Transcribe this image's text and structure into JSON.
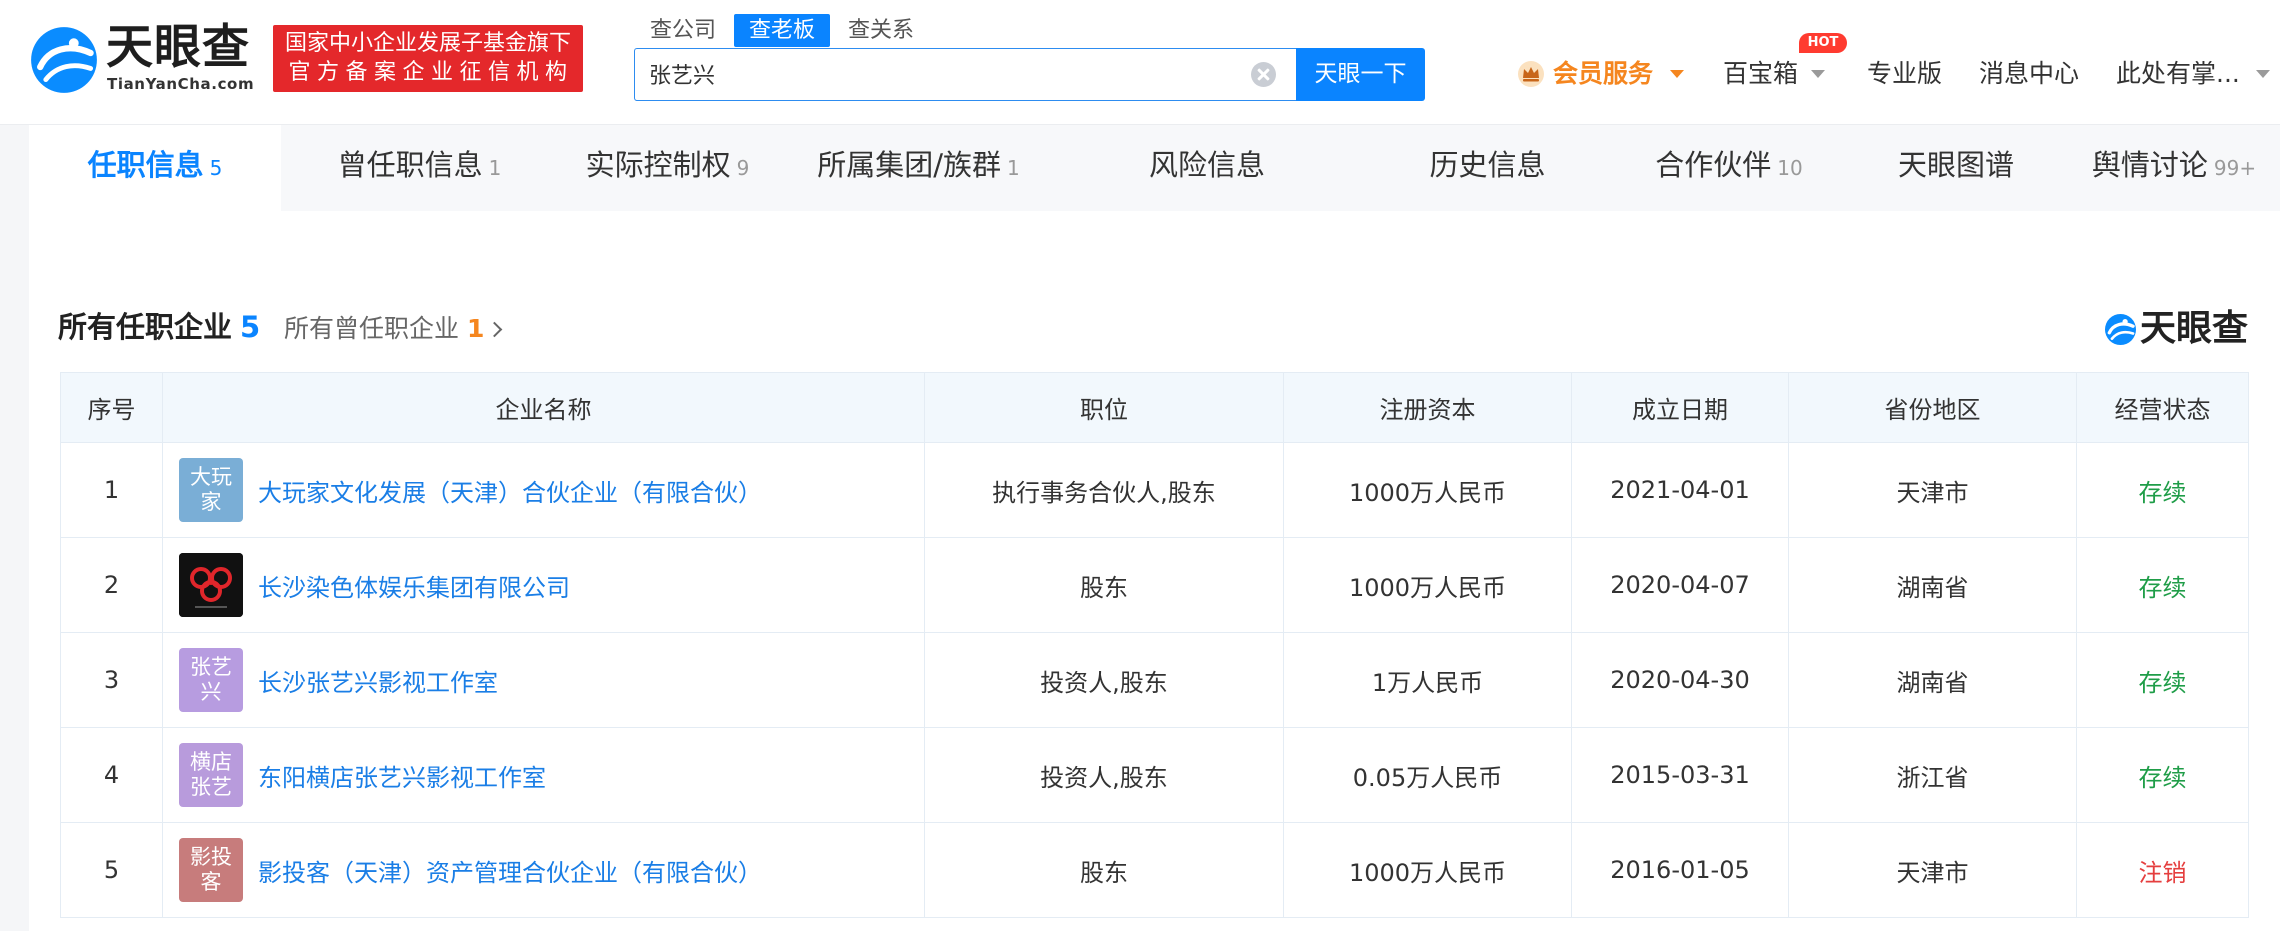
{
  "header": {
    "brand": "天眼查",
    "brand_sub": "TianYanCha.com",
    "banner_line1": "国家中小企业发展子基金旗下",
    "banner_line2": "官方备案企业征信机构",
    "search_tabs": [
      "查公司",
      "查老板",
      "查关系"
    ],
    "search_active_index": 1,
    "search_value": "张艺兴",
    "search_button": "天眼一下",
    "nav": {
      "vip": "会员服务",
      "toolbox": "百宝箱",
      "toolbox_badge": "HOT",
      "pro": "专业版",
      "messages": "消息中心",
      "user": "此处有掌..."
    }
  },
  "tabs": [
    {
      "label": "任职信息",
      "count": "5",
      "active": true
    },
    {
      "label": "曾任职信息",
      "count": "1"
    },
    {
      "label": "实际控制权",
      "count": "9"
    },
    {
      "label": "所属集团/族群",
      "count": "1"
    },
    {
      "label": "风险信息"
    },
    {
      "label": "历史信息"
    },
    {
      "label": "合作伙伴",
      "count": "10"
    },
    {
      "label": "天眼图谱"
    },
    {
      "label": "舆情讨论",
      "count": "99+"
    }
  ],
  "section": {
    "title": "所有任职企业",
    "count": "5",
    "former_label": "所有曾任职企业",
    "former_count": "1"
  },
  "watermark": "天眼查",
  "table": {
    "headers": [
      "序号",
      "企业名称",
      "职位",
      "注册资本",
      "成立日期",
      "省份地区",
      "经营状态"
    ],
    "rows": [
      {
        "index": "1",
        "logo": [
          "大玩",
          "家"
        ],
        "logo_color": "#7aaed6",
        "name": "大玩家文化发展（天津）合伙企业（有限合伙）",
        "position": "执行事务合伙人,股东",
        "capital": "1000万人民币",
        "founded": "2021-04-01",
        "region": "天津市",
        "status": "存续",
        "status_color": "#1f9d48"
      },
      {
        "index": "2",
        "logo_icon": "chromosome-logo-icon",
        "logo_color": "#111111",
        "name": "长沙染色体娱乐集团有限公司",
        "position": "股东",
        "capital": "1000万人民币",
        "founded": "2020-04-07",
        "region": "湖南省",
        "status": "存续",
        "status_color": "#1f9d48"
      },
      {
        "index": "3",
        "logo": [
          "张艺",
          "兴"
        ],
        "logo_color": "#b79ce0",
        "name": "长沙张艺兴影视工作室",
        "position": "投资人,股东",
        "capital": "1万人民币",
        "founded": "2020-04-30",
        "region": "湖南省",
        "status": "存续",
        "status_color": "#1f9d48"
      },
      {
        "index": "4",
        "logo": [
          "横店",
          "张艺"
        ],
        "logo_color": "#b89bdc",
        "name": "东阳横店张艺兴影视工作室",
        "position": "投资人,股东",
        "capital": "0.05万人民币",
        "founded": "2015-03-31",
        "region": "浙江省",
        "status": "存续",
        "status_color": "#1f9d48"
      },
      {
        "index": "5",
        "logo": [
          "影投",
          "客"
        ],
        "logo_color": "#c77c7c",
        "name": "影投客（天津）资产管理合伙企业（有限合伙）",
        "position": "股东",
        "capital": "1000万人民币",
        "founded": "2016-01-05",
        "region": "天津市",
        "status": "注销",
        "status_color": "#e53e3e"
      }
    ]
  },
  "icons": [
    "tianyancha-logo-icon",
    "clear-search-icon",
    "crown-icon",
    "chevron-down-icon",
    "chevron-right-icon",
    "chromosome-logo-icon"
  ],
  "colors": {
    "brand_blue": "#0a84ff",
    "link_blue": "#1a7ee6",
    "vip_orange": "#f5861f",
    "banner_red": "#e4282b",
    "hot_red": "#ff3b30",
    "status_active": "#1f9d48",
    "status_cancelled": "#e53e3e",
    "table_header_bg": "#f2f8fd"
  }
}
